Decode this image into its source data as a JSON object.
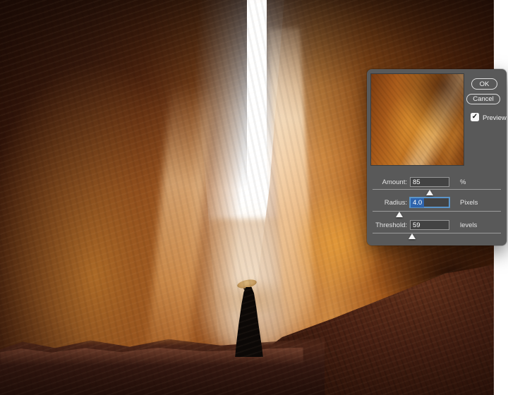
{
  "photo": {
    "colors": {
      "left_wall_dark": "#2f1207",
      "left_wall_lit": "#9c5420",
      "light_shaft": "#ffffff",
      "right_wall_lit": "#cd8840",
      "right_wall_dark": "#4e2009",
      "foreground_rock": "#33150a",
      "haze": "#e6cdb2",
      "hat": "#c59a5e",
      "cloak": "#0c0806",
      "margin_strip": "#ffffff"
    }
  },
  "dialog": {
    "background": "#595959",
    "accent_focus": "#5b9bd5",
    "selection_color": "#2e64ad",
    "buttons": {
      "ok": "OK",
      "cancel": "Cancel"
    },
    "preview": {
      "label": "Preview",
      "checked": true,
      "checkmark": "✓"
    },
    "fields": [
      {
        "label": "Amount:",
        "value": "85",
        "unit": "%",
        "slider_percent": 45,
        "focused": false
      },
      {
        "label": "Radius:",
        "value": "4.0",
        "unit": "Pixels",
        "slider_percent": 21,
        "focused": true
      },
      {
        "label": "Threshold:",
        "value": "59",
        "unit": "levels",
        "slider_percent": 31,
        "focused": false
      }
    ]
  }
}
